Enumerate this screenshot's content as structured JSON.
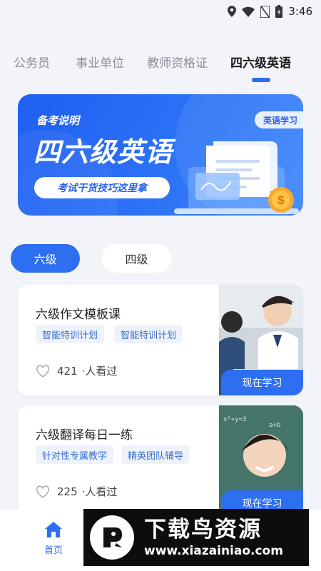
{
  "status_bar": {
    "time": "3:46"
  },
  "top_tabs": [
    {
      "label": "公务员"
    },
    {
      "label": "事业单位"
    },
    {
      "label": "教师资格证"
    },
    {
      "label": "四六级英语",
      "active": true
    }
  ],
  "banner": {
    "kicker": "备考说明",
    "title": "四六级英语",
    "pill": "考试干货技巧这里拿",
    "tag": "英语学习",
    "coin_symbol": "$"
  },
  "level_tabs": [
    {
      "label": "六级",
      "active": true
    },
    {
      "label": "四级",
      "active": false
    }
  ],
  "courses": [
    {
      "title": "六级作文模板课",
      "tags": [
        "智能特训计划",
        "智能特训计划"
      ],
      "views": "421",
      "views_suffix": "·人看过",
      "button": "现在学习"
    },
    {
      "title": "六级翻译每日一练",
      "tags": [
        "针对性专属教学",
        "精英团队辅导"
      ],
      "views": "225",
      "views_suffix": "·人看过",
      "button": "现在学习"
    }
  ],
  "bottom_nav": {
    "home_label": "首页"
  },
  "watermark": {
    "title": "下载鸟资源",
    "url": "www.xiazainiao.com"
  },
  "colors": {
    "accent": "#2e6ef0",
    "page_bg": "#f2f4f9",
    "tag_bg": "#eef3fb",
    "tag_text": "#3a6fd1"
  }
}
